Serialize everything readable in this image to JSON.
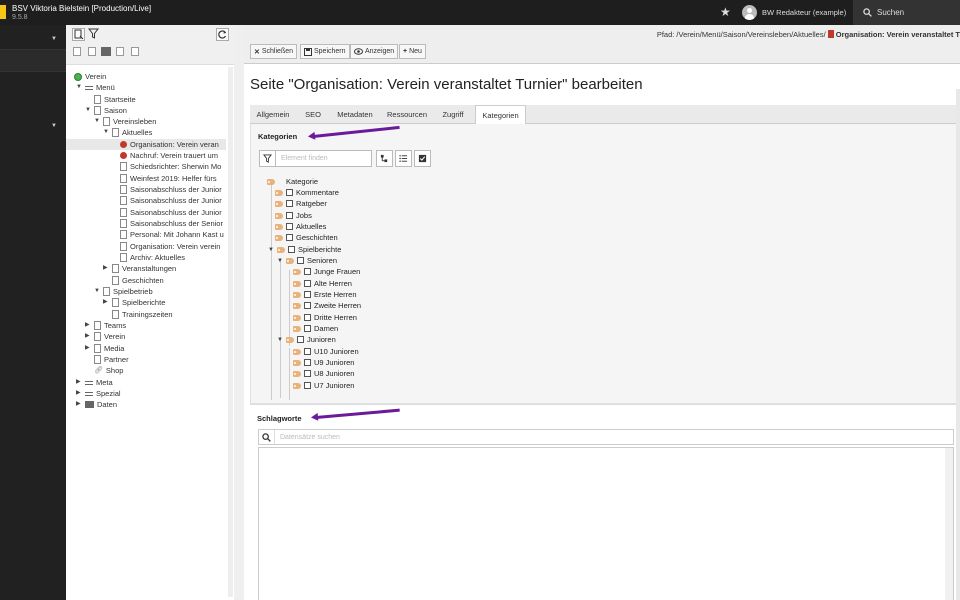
{
  "topbar": {
    "site_name": "BSV Viktoria Bielstein [Production/Live]",
    "version": "9.5.8",
    "user": "BW Redakteur (example)",
    "search_label": "Suchen"
  },
  "tree": {
    "nodes": [
      {
        "label": "Verein"
      },
      {
        "label": "Menü"
      },
      {
        "label": "Startseite"
      },
      {
        "label": "Saison"
      },
      {
        "label": "Vereinsleben"
      },
      {
        "label": "Aktuelles"
      },
      {
        "label": "Organisation: Verein veran"
      },
      {
        "label": "Nachruf: Verein trauert um"
      },
      {
        "label": "Schiedsrichter: Sherwin Mo"
      },
      {
        "label": "Weinfest 2019: Helfer fürs"
      },
      {
        "label": "Saisonabschluss der Junior"
      },
      {
        "label": "Saisonabschluss der Junior"
      },
      {
        "label": "Saisonabschluss der Junior"
      },
      {
        "label": "Saisonabschluss der Senior"
      },
      {
        "label": "Personal: Mit Johann Kast u"
      },
      {
        "label": "Organisation: Verein verein"
      },
      {
        "label": "Archiv: Aktuelles"
      },
      {
        "label": "Veranstaltungen"
      },
      {
        "label": "Geschichten"
      },
      {
        "label": "Spielbetrieb"
      },
      {
        "label": "Spielberichte"
      },
      {
        "label": "Trainingszeiten"
      },
      {
        "label": "Teams"
      },
      {
        "label": "Verein"
      },
      {
        "label": "Media"
      },
      {
        "label": "Partner"
      },
      {
        "label": "Shop"
      },
      {
        "label": "Meta"
      },
      {
        "label": "Spezial"
      },
      {
        "label": "Daten"
      }
    ]
  },
  "docheader": {
    "path_label": "Pfad: /Verein/Menü/Saison/Vereinsleben/Aktuelles/",
    "path_current": "Organisation: Verein veranstaltet T",
    "buttons": {
      "close": "Schließen",
      "save": "Speichern",
      "view": "Anzeigen",
      "new": "Neu"
    }
  },
  "page_title": "Seite \"Organisation: Verein veranstaltet Turnier\" bearbeiten",
  "tabs": [
    {
      "label": "Allgemein"
    },
    {
      "label": "SEO"
    },
    {
      "label": "Metadaten"
    },
    {
      "label": "Ressourcen"
    },
    {
      "label": "Zugriff"
    },
    {
      "label": "Kategorien"
    }
  ],
  "categories": {
    "label": "Kategorien",
    "filter_placeholder": "Element finden",
    "items": [
      {
        "label": "Kategorie"
      },
      {
        "label": "Kommentare"
      },
      {
        "label": "Ratgeber"
      },
      {
        "label": "Jobs"
      },
      {
        "label": "Aktuelles"
      },
      {
        "label": "Geschichten"
      },
      {
        "label": "Spielberichte"
      },
      {
        "label": "Senioren"
      },
      {
        "label": "Junge Frauen"
      },
      {
        "label": "Alte Herren"
      },
      {
        "label": "Erste Herren"
      },
      {
        "label": "Zweite Herren"
      },
      {
        "label": "Dritte Herren"
      },
      {
        "label": "Damen"
      },
      {
        "label": "Junioren"
      },
      {
        "label": "U10 Junioren"
      },
      {
        "label": "U9 Junioren"
      },
      {
        "label": "U8 Junioren"
      },
      {
        "label": "U7 Junioren"
      }
    ]
  },
  "keywords": {
    "label": "Schlagworte",
    "search_placeholder": "Datensätze suchen"
  },
  "colors": {
    "annotation_arrow": "#6a1b9a",
    "topbar": "#1e1e1e",
    "module_menu": "#212121"
  }
}
